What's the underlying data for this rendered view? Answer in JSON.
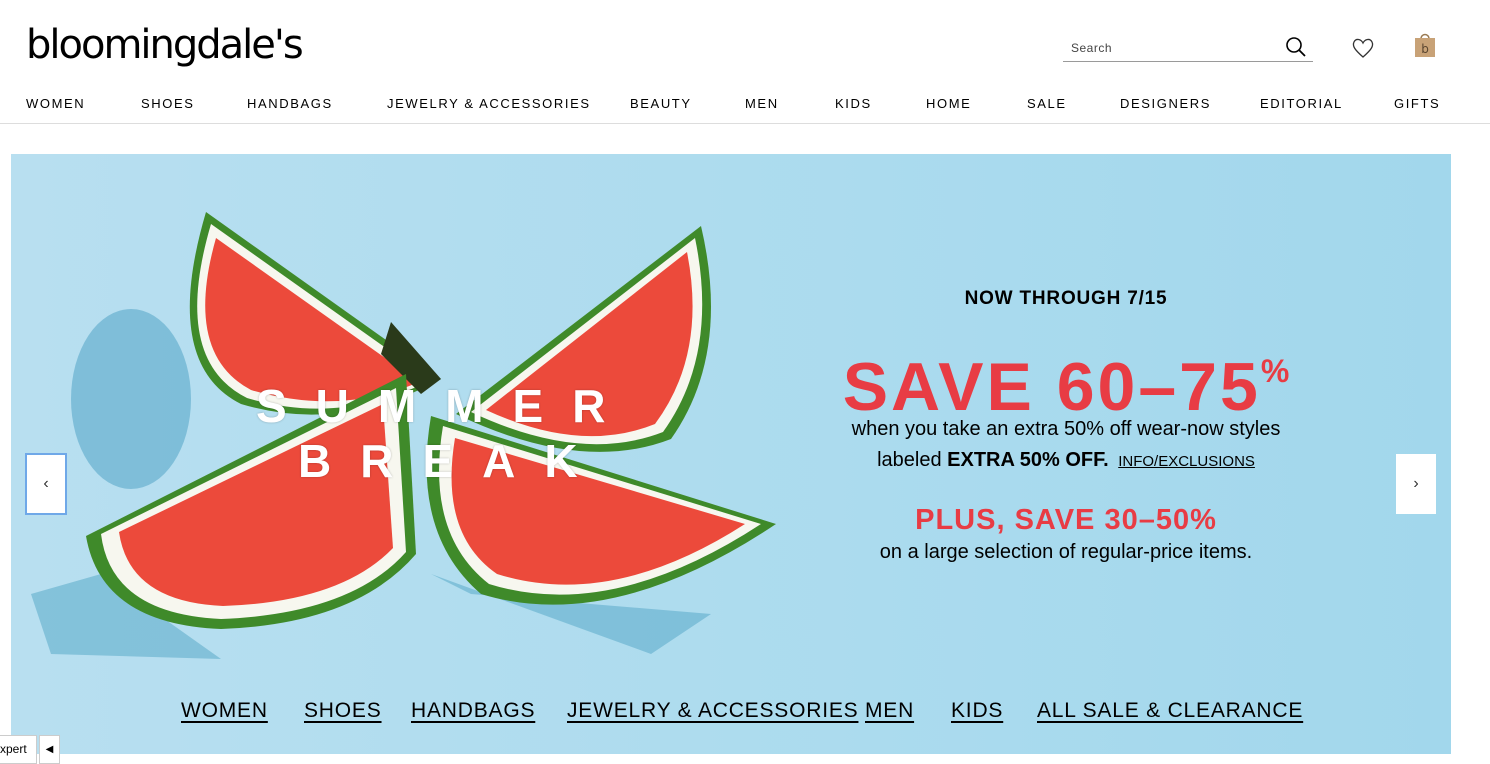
{
  "header": {
    "logo": "bloomingdale's",
    "search": {
      "placeholder": "Search"
    }
  },
  "nav": {
    "items": [
      "WOMEN",
      "SHOES",
      "HANDBAGS",
      "JEWELRY & ACCESSORIES",
      "BEAUTY",
      "MEN",
      "KIDS",
      "HOME",
      "SALE",
      "DESIGNERS",
      "EDITORIAL",
      "GIFTS"
    ]
  },
  "hero": {
    "title_line1": "SUMMER",
    "title_line2": "BREAK",
    "dates": "NOW THROUGH 7/15",
    "save": "SAVE 60–75",
    "save_pct": "%",
    "line1": "when you take an extra 50% off wear-now styles",
    "line2_prefix": "labeled",
    "line2_bold": "EXTRA 50% OFF.",
    "info_link": "INFO/EXCLUSIONS",
    "plus": "PLUS, SAVE 30–50%",
    "line3": "on a large selection of regular-price items.",
    "links": [
      "WOMEN",
      "SHOES",
      "HANDBAGS",
      "JEWELRY & ACCESSORIES",
      "MEN",
      "KIDS",
      "ALL SALE & CLEARANCE"
    ],
    "prev_arrow": "‹",
    "next_arrow": "›"
  },
  "expert_tab": {
    "label": "xpert",
    "toggle": "◀"
  },
  "colors": {
    "accent_red": "#e83c44",
    "hero_bg": "#abdbee"
  }
}
